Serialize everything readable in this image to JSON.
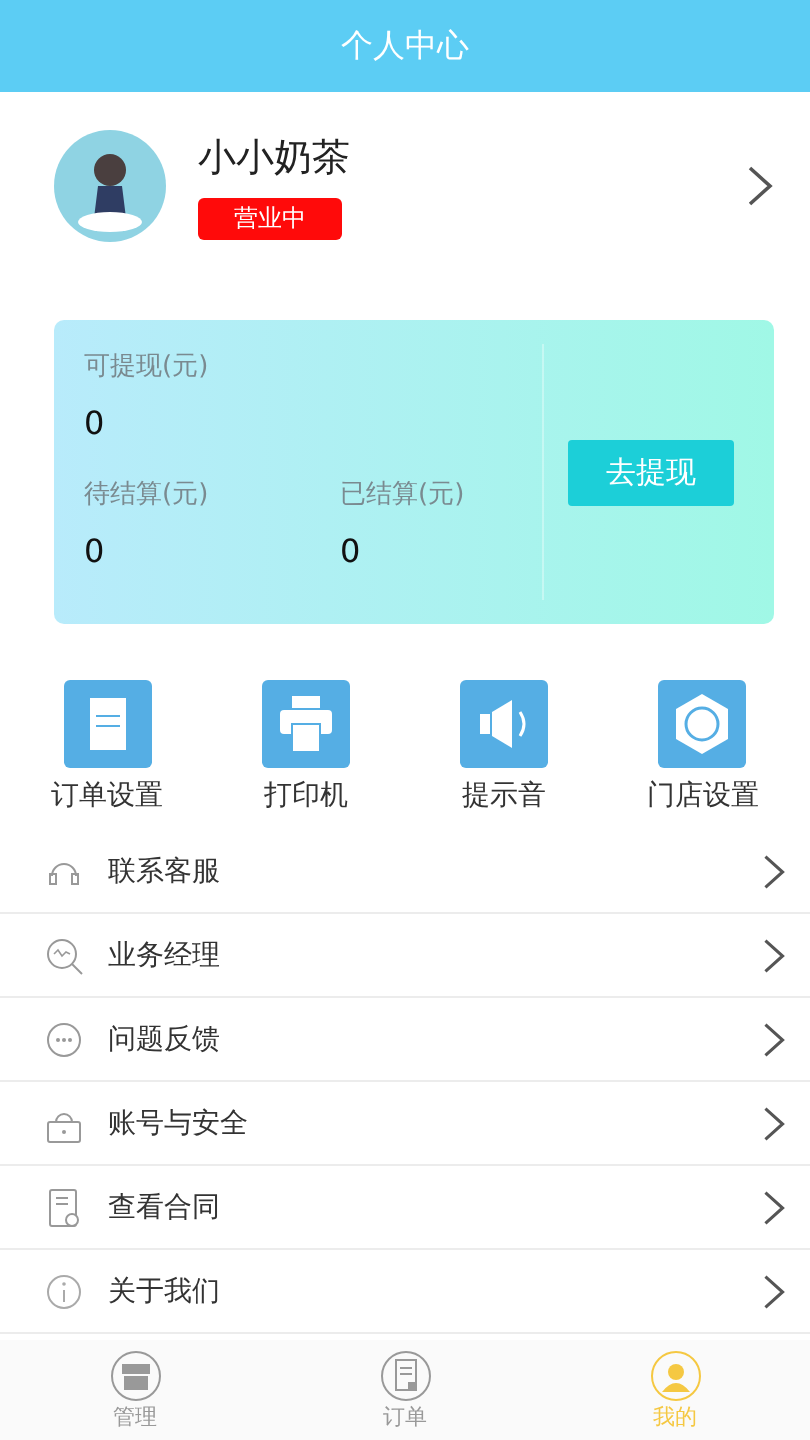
{
  "header": {
    "title": "个人中心"
  },
  "profile": {
    "name": "小小奶茶",
    "status": "营业中"
  },
  "wallet": {
    "withdrawable": {
      "label": "可提现(元)",
      "value": "0"
    },
    "pending": {
      "label": "待结算(元)",
      "value": "0"
    },
    "settled": {
      "label": "已结算(元)",
      "value": "0"
    },
    "button": "去提现"
  },
  "shortcuts": [
    {
      "label": "订单设置"
    },
    {
      "label": "打印机"
    },
    {
      "label": "提示音"
    },
    {
      "label": "门店设置"
    }
  ],
  "menu": [
    {
      "label": "联系客服"
    },
    {
      "label": "业务经理"
    },
    {
      "label": "问题反馈"
    },
    {
      "label": "账号与安全"
    },
    {
      "label": "查看合同"
    },
    {
      "label": "关于我们"
    }
  ],
  "tabs": [
    {
      "label": "管理",
      "selected": false
    },
    {
      "label": "订单",
      "selected": false
    },
    {
      "label": "我的",
      "selected": true
    }
  ]
}
